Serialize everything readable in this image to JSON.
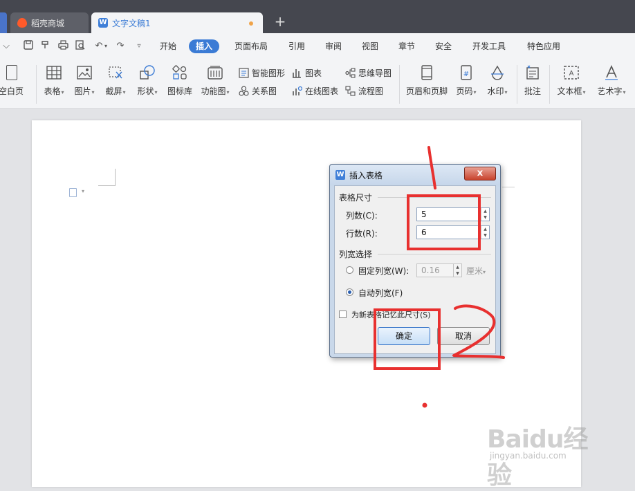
{
  "tabs": [
    {
      "label": "稻壳商城",
      "icon": "flame-icon"
    },
    {
      "label": "文字文稿1",
      "icon": "wps-writer-icon"
    }
  ],
  "menu": {
    "items": [
      "开始",
      "插入",
      "页面布局",
      "引用",
      "审阅",
      "视图",
      "章节",
      "安全",
      "开发工具",
      "特色应用"
    ],
    "active": "插入"
  },
  "ribbon": {
    "blank_page": "空白页",
    "table": "表格",
    "picture": "图片",
    "screenshot": "截屏",
    "shape": "形状",
    "icon_lib": "图标库",
    "func_chart": "功能图",
    "smart_shape": "智能图形",
    "chart": "图表",
    "mind_map": "思维导图",
    "relation": "关系图",
    "online_chart": "在线图表",
    "flowchart": "流程图",
    "header_footer": "页眉和页脚",
    "page_num": "页码",
    "watermark": "水印",
    "comment": "批注",
    "textbox": "文本框",
    "wordart": "艺术字"
  },
  "dialog": {
    "title": "插入表格",
    "close": "x",
    "size_section": "表格尺寸",
    "cols_label": "列数(C):",
    "cols_value": "5",
    "rows_label": "行数(R):",
    "rows_value": "6",
    "width_section": "列宽选择",
    "fixed_label": "固定列宽(W):",
    "fixed_value": "0.16",
    "fixed_unit": "厘米",
    "auto_label": "自动列宽(F)",
    "remember_label": "为新表格记忆此尺寸(S)",
    "ok": "确定",
    "cancel": "取消"
  },
  "annotations": {
    "color": "#e8302f",
    "step1": "1",
    "step2": "2"
  },
  "watermark": {
    "brand": "Baidu经验",
    "url": "jingyan.baidu.com"
  },
  "colors": {
    "accent": "#3b7bd5",
    "tabbar": "#45474f",
    "annotation": "#e8302f"
  }
}
